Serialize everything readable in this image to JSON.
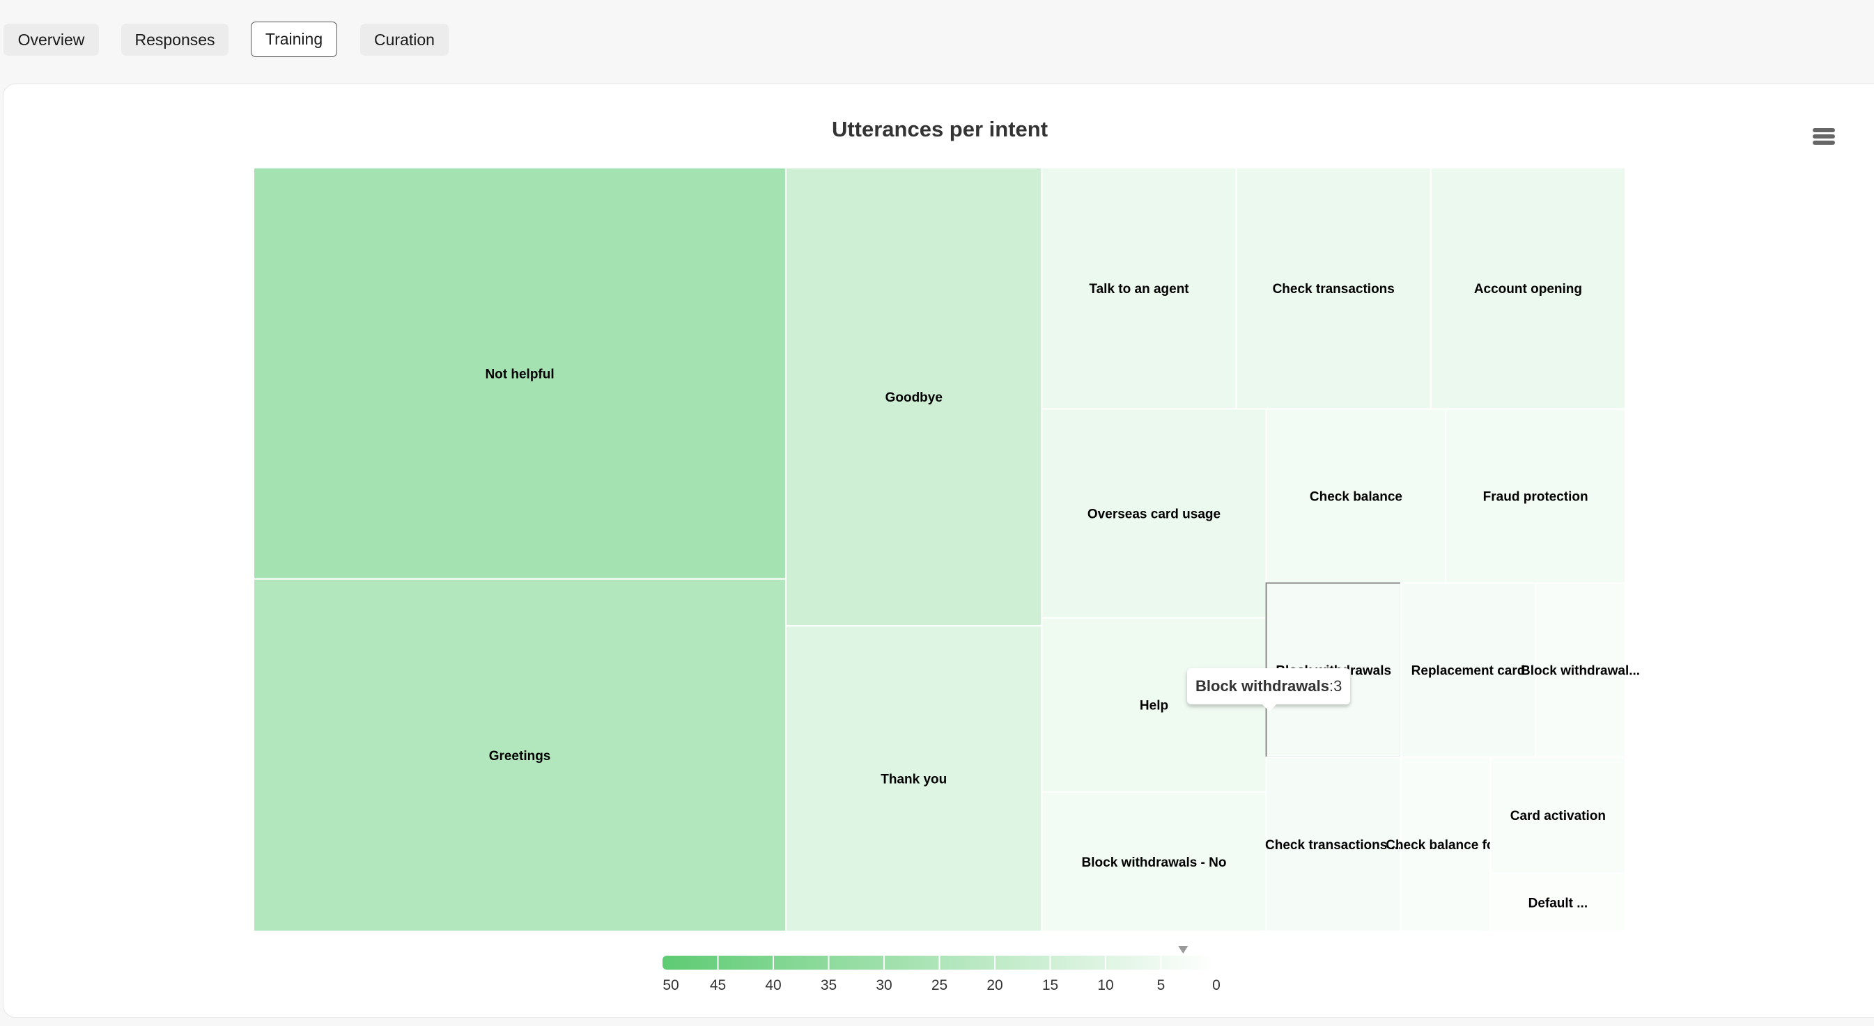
{
  "tabs": [
    {
      "label": "Overview",
      "active": false
    },
    {
      "label": "Responses",
      "active": false
    },
    {
      "label": "Training",
      "active": true
    },
    {
      "label": "Curation",
      "active": false
    }
  ],
  "menu_icon": "hamburger-menu-icon",
  "tooltip": {
    "name": "Block withdrawals",
    "separator": ": ",
    "value": "3"
  },
  "chart_data": {
    "type": "treemap",
    "title": "Utterances per intent",
    "value_label": "Utterances",
    "items": [
      {
        "name": "Not helpful",
        "value": 28
      },
      {
        "name": "Greetings",
        "value": 24
      },
      {
        "name": "Goodbye",
        "value": 15
      },
      {
        "name": "Thank you",
        "value": 10
      },
      {
        "name": "Talk to an agent",
        "value": 6
      },
      {
        "name": "Check transactions",
        "value": 6
      },
      {
        "name": "Account opening",
        "value": 6
      },
      {
        "name": "Overseas card usage",
        "value": 6
      },
      {
        "name": "Help",
        "value": 5
      },
      {
        "name": "Block withdrawals - No",
        "value": 4
      },
      {
        "name": "Check balance",
        "value": 4
      },
      {
        "name": "Fraud protection",
        "value": 4
      },
      {
        "name": "Block withdrawals",
        "value": 3,
        "hovered": true
      },
      {
        "name": "Check transactions ...",
        "value": 3
      },
      {
        "name": "Replacement card",
        "value": 3
      },
      {
        "name": "Block withdrawal...",
        "value": 2
      },
      {
        "name": "Check balance fo...",
        "value": 2
      },
      {
        "name": "Card activation",
        "value": 2
      },
      {
        "name": "Default ...",
        "value": 1
      }
    ],
    "color_axis": {
      "min": 0,
      "max": 50,
      "reversed": true,
      "min_color": "#ffffff",
      "max_color": "#5ecb73",
      "tick_labels": [
        "50",
        "45",
        "40",
        "35",
        "30",
        "25",
        "20",
        "15",
        "10",
        "5",
        "0"
      ],
      "marker_value": 3
    }
  }
}
